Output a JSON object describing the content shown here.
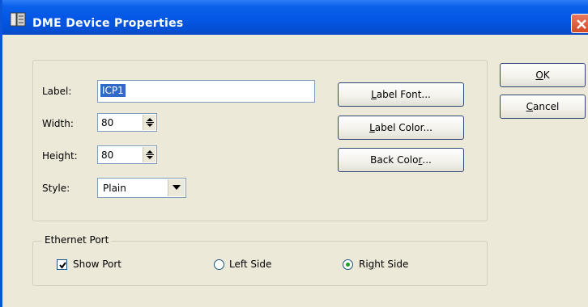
{
  "window": {
    "title": "DME Device Properties",
    "icon": "dme-app-icon",
    "close_icon": "close-icon"
  },
  "form": {
    "label": {
      "caption": "Label:",
      "value": "ICP1"
    },
    "width": {
      "caption": "Width:",
      "value": "80"
    },
    "height": {
      "caption": "Height:",
      "value": "80"
    },
    "style": {
      "caption": "Style:",
      "selected": "Plain"
    }
  },
  "buttons": {
    "label_font": {
      "mnemonic": "L",
      "rest": "abel Font..."
    },
    "label_color": {
      "mnemonic": "L",
      "rest": "abel Color..."
    },
    "back_color": {
      "prefix": "Back Colo",
      "mnemonic": "r",
      "suffix": "..."
    },
    "ok": {
      "mnemonic": "O",
      "rest": "K"
    },
    "cancel": {
      "mnemonic": "C",
      "rest": "ancel"
    }
  },
  "ethernet": {
    "group_title": "Ethernet Port",
    "show_port": {
      "label": "Show Port",
      "checked": true
    },
    "left_side": {
      "label": "Left Side",
      "selected": false
    },
    "right_side": {
      "prefix": "Ri",
      "mnemonic": "g",
      "rest": "ht Side",
      "selected": true
    }
  },
  "colors": {
    "titlebar": "#0456e4",
    "dialog_bg": "#ece9d8",
    "selection": "#316ac5",
    "close_button": "#d64a25",
    "radio_dot": "#21a121"
  }
}
